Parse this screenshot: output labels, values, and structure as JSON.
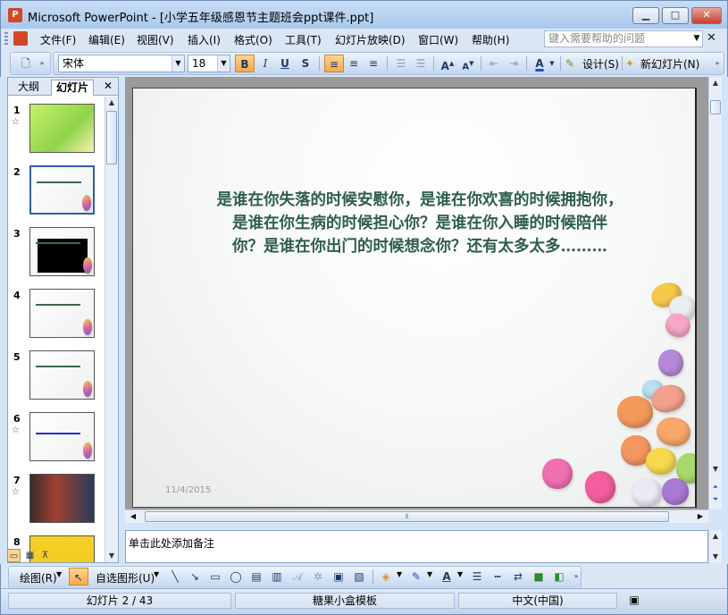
{
  "window": {
    "app_name": "Microsoft PowerPoint",
    "title": "Microsoft PowerPoint - [小学五年级感恩节主题班会ppt课件.ppt]",
    "buttons": {
      "minimize": "▁",
      "maximize": "□",
      "close": "✕"
    }
  },
  "menubar": {
    "items": [
      "文件(F)",
      "编辑(E)",
      "视图(V)",
      "插入(I)",
      "格式(O)",
      "工具(T)",
      "幻灯片放映(D)",
      "窗口(W)",
      "帮助(H)"
    ],
    "help_placeholder": "键入需要帮助的问题",
    "doc_close": "✕"
  },
  "toolbar": {
    "font_name": "宋体",
    "font_size": "18",
    "bold": "B",
    "italic": "I",
    "underline": "U",
    "shadow": "S",
    "design_label": "设计(S)",
    "new_slide_label": "新幻灯片(N)"
  },
  "outline_pane": {
    "tabs": [
      "大纲",
      "幻灯片"
    ],
    "selected_tab": "幻灯片",
    "close": "✕",
    "slides": [
      {
        "number": "1",
        "has_star": true
      },
      {
        "number": "2",
        "has_star": false
      },
      {
        "number": "3",
        "has_star": false
      },
      {
        "number": "4",
        "has_star": false
      },
      {
        "number": "5",
        "has_star": false
      },
      {
        "number": "6",
        "has_star": true
      },
      {
        "number": "7",
        "has_star": true
      },
      {
        "number": "8",
        "has_star": false
      }
    ],
    "star_glyph": "☆"
  },
  "slide": {
    "body_text_lines": [
      "是谁在你失落的时候安慰你，是谁在你欢喜的时候拥抱你，",
      "是谁在你生病的时候担心你？是谁在你入睡的时候陪伴",
      "你？是谁在你出门的时候想念你？还有太多太多………"
    ],
    "date": "11/4/2015",
    "text_color": "#2f5e4a"
  },
  "notes": {
    "placeholder": "单击此处添加备注"
  },
  "drawbar": {
    "draw_label": "绘图(R)",
    "autoshape_label": "自选图形(U)"
  },
  "statusbar": {
    "slide_position": "幻灯片 2 / 43",
    "template": "糖果小盒模板",
    "language": "中文(中国)"
  },
  "colors": {
    "accent": "#f7a84a",
    "chrome": "#dbe6f4",
    "border": "#6d8db5"
  }
}
